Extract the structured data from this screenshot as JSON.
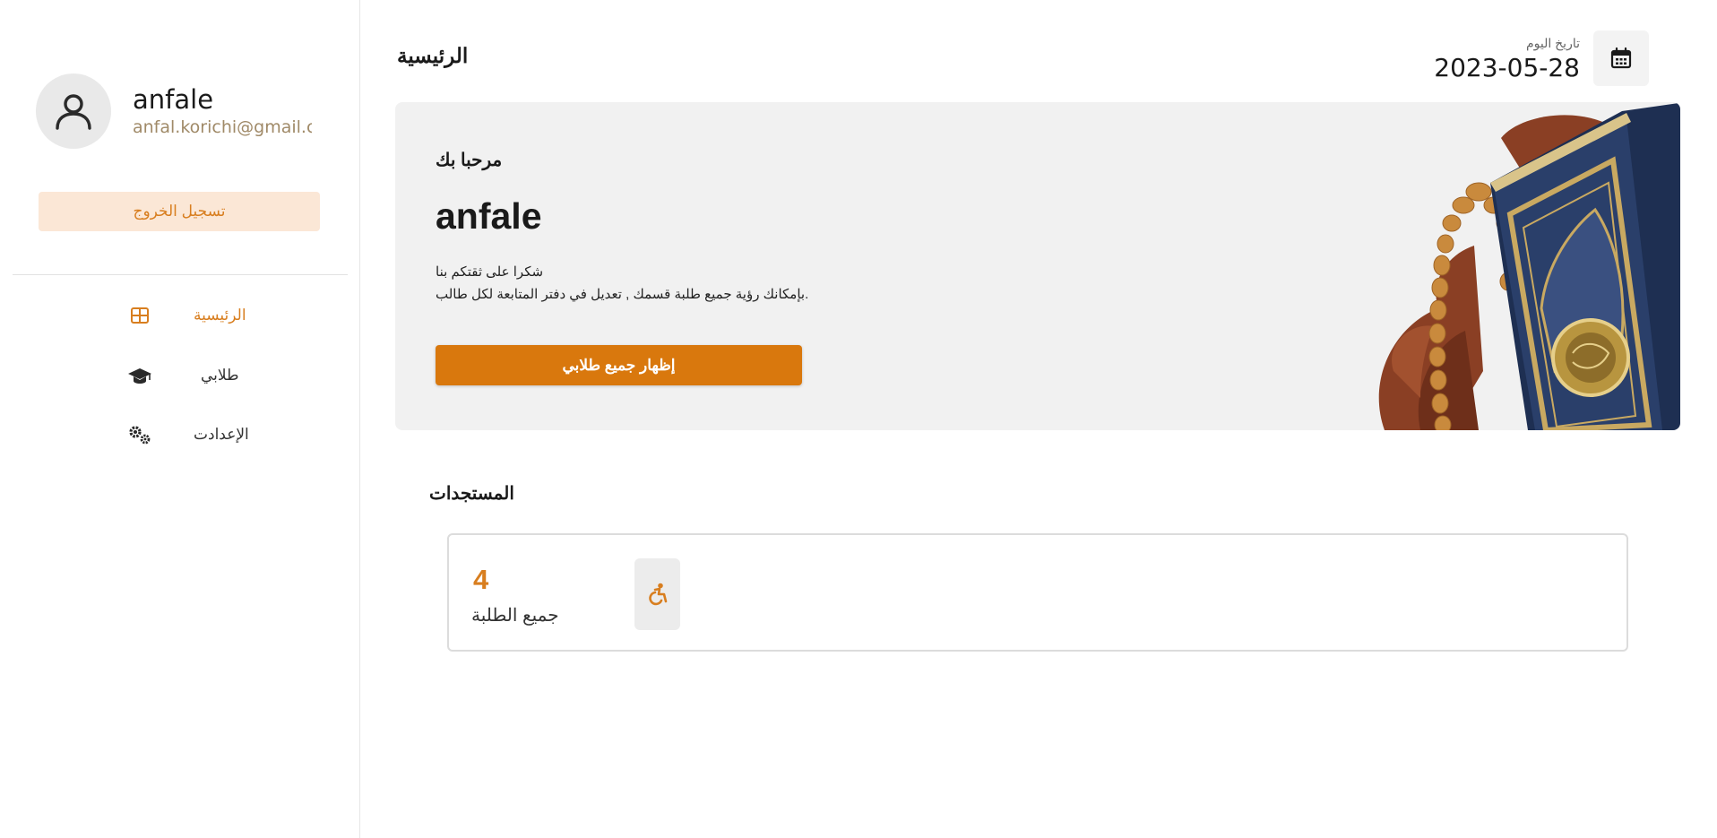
{
  "sidebar": {
    "user": {
      "name": "anfale",
      "email": "anfal.korichi@gmail.co"
    },
    "logout_label": "تسجيل الخروج",
    "nav": [
      {
        "label": "الرئيسية",
        "icon": "grid-icon",
        "active": true
      },
      {
        "label": "طلابي",
        "icon": "graduation-cap-icon",
        "active": false
      },
      {
        "label": "الإعدادت",
        "icon": "gears-icon",
        "active": false
      }
    ]
  },
  "header": {
    "title": "الرئيسية",
    "date_caption": "تاريخ اليوم",
    "date_value": "2023-05-28",
    "calendar_icon": "calendar-icon"
  },
  "hero": {
    "welcome": "مرحبا بك",
    "name": "anfale",
    "line1": "شكرا على ثقتكم بنا",
    "line2": "بإمكانك رؤية جميع طلبة قسمك , تعديل في دفتر المتابعة لكل طالب.",
    "button_label": "إظهار جميع طلابي"
  },
  "updates": {
    "title": "المستجدات",
    "stats": [
      {
        "value": "4",
        "label": "جميع الطلبة",
        "icon": "accessible-icon"
      }
    ]
  },
  "colors": {
    "accent": "#d87e1f",
    "accent_light": "#fbe7d6",
    "button": "#d9780d"
  }
}
